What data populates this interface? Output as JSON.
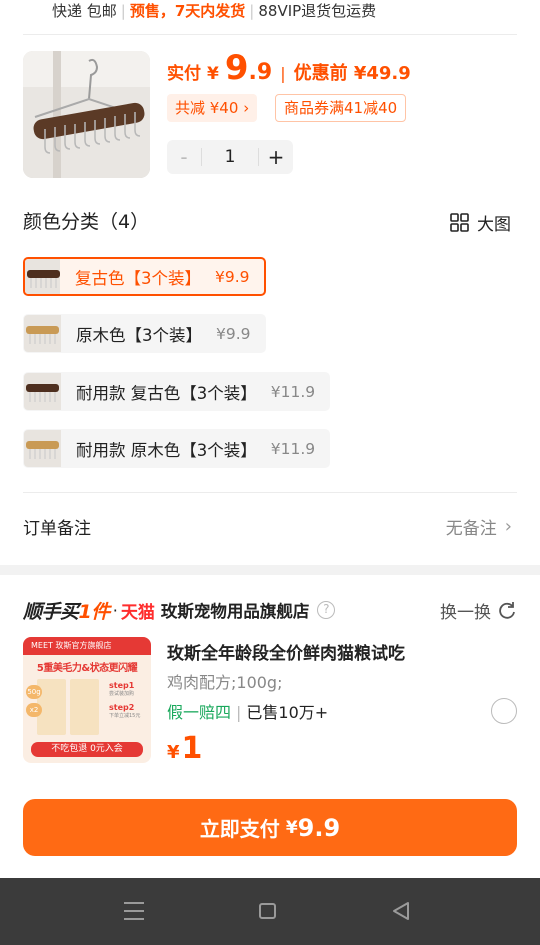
{
  "shipping": {
    "left": "快递 包邮",
    "presale": "预售，7天内发货",
    "return": "88VIP退货包运费"
  },
  "product": {
    "paid_label": "实付",
    "currency": "¥",
    "price_int": "9",
    "price_dec": ".9",
    "pre_discount": "优惠前 ¥49.9",
    "save_chip": "共减 ¥40",
    "coupon_chip": "商品券满41减40",
    "qty_minus": "-",
    "qty": "1",
    "qty_plus": "+"
  },
  "variants": {
    "title": "颜色分类（4）",
    "big_view": "大图",
    "items": [
      {
        "name": "复古色【3个装】",
        "price": "¥9.9",
        "selected": true
      },
      {
        "name": "原木色【3个装】",
        "price": "¥9.9",
        "selected": false
      },
      {
        "name": "耐用款 复古色【3个装】",
        "price": "¥11.9",
        "selected": false
      },
      {
        "name": "耐用款 原木色【3个装】",
        "price": "¥11.9",
        "selected": false
      }
    ]
  },
  "remark": {
    "label": "订单备注",
    "value": "无备注"
  },
  "recommend": {
    "logo_a": "顺手买",
    "logo_b": "1件",
    "tmall": "天猫",
    "shop": "玫斯宠物用品旗舰店",
    "swap": "换一换",
    "title": "玫斯全年龄段全价鲜肉猫粮试吃",
    "spec": "鸡肉配方;100g;",
    "tag_guarantee": "假一赔四",
    "tag_sold": "已售10万+",
    "price_currency": "¥",
    "price": "1",
    "img": {
      "header": "MEET 玫斯官方旗舰店",
      "headline": "5重美毛力&状态更闪耀",
      "badge1": "50g",
      "badge2": "x2",
      "step1": "step1",
      "step1_sub": "尝试装加购",
      "step2": "step2",
      "step2_sub": "下单立减15元",
      "footer": "不吃包退 0元入会"
    }
  },
  "pay": {
    "label": "立即支付",
    "currency": "¥",
    "amount": "9.9"
  }
}
